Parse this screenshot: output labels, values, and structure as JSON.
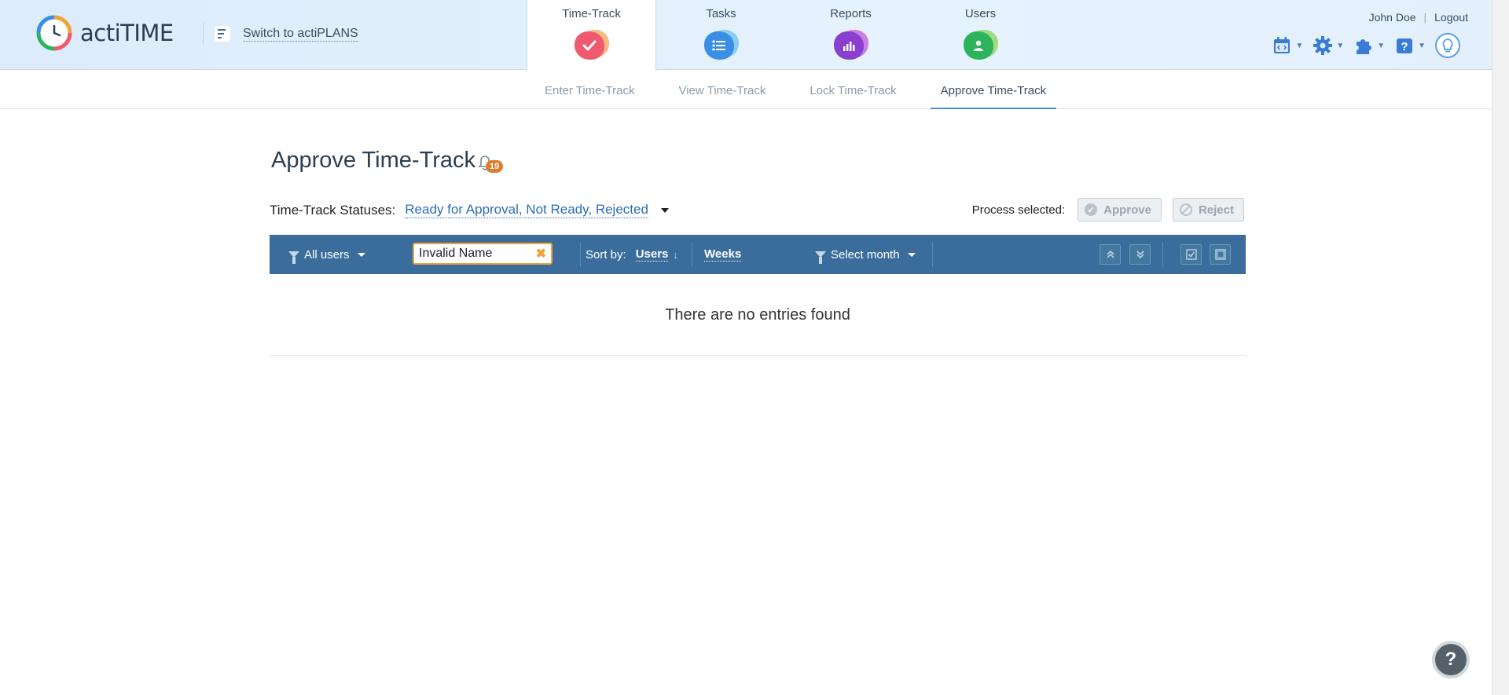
{
  "app": {
    "logo_text": "actiTIME",
    "switch_label": "Switch to actiPLANS"
  },
  "main_tabs": [
    {
      "label": "Time-Track",
      "color": "#ef5a6f",
      "accent": "#f5a25a",
      "icon": "check-icon"
    },
    {
      "label": "Tasks",
      "color": "#3a8ee6",
      "accent": "#6cc2f0",
      "icon": "list-icon"
    },
    {
      "label": "Reports",
      "color": "#8a3fd0",
      "accent": "#c05ad6",
      "icon": "bar-chart-icon"
    },
    {
      "label": "Users",
      "color": "#2db45a",
      "accent": "#8fd05a",
      "icon": "user-icon"
    }
  ],
  "header": {
    "user_name": "John Doe",
    "separator": "|",
    "logout": "Logout"
  },
  "sub_tabs": [
    {
      "label": "Enter Time-Track"
    },
    {
      "label": "View Time-Track"
    },
    {
      "label": "Lock Time-Track"
    },
    {
      "label": "Approve Time-Track"
    }
  ],
  "page": {
    "title": "Approve Time-Track",
    "notification_count": "19",
    "statuses_label": "Time-Track Statuses:",
    "statuses_value": "Ready for Approval, Not Ready, Rejected",
    "process_label": "Process selected:",
    "approve_label": "Approve",
    "reject_label": "Reject"
  },
  "filterbar": {
    "users_filter": "All users",
    "search_value": "Invalid Name",
    "sort_label": "Sort by:",
    "sort_value": "Users",
    "group_value": "Weeks",
    "month_filter": "Select month"
  },
  "empty_message": "There are no entries found",
  "help_label": "?",
  "colors": {
    "filterbar_bg": "#3a6d9c",
    "link": "#2a6db8",
    "search_border": "#f0a23a",
    "badge": "#e07a2c"
  }
}
